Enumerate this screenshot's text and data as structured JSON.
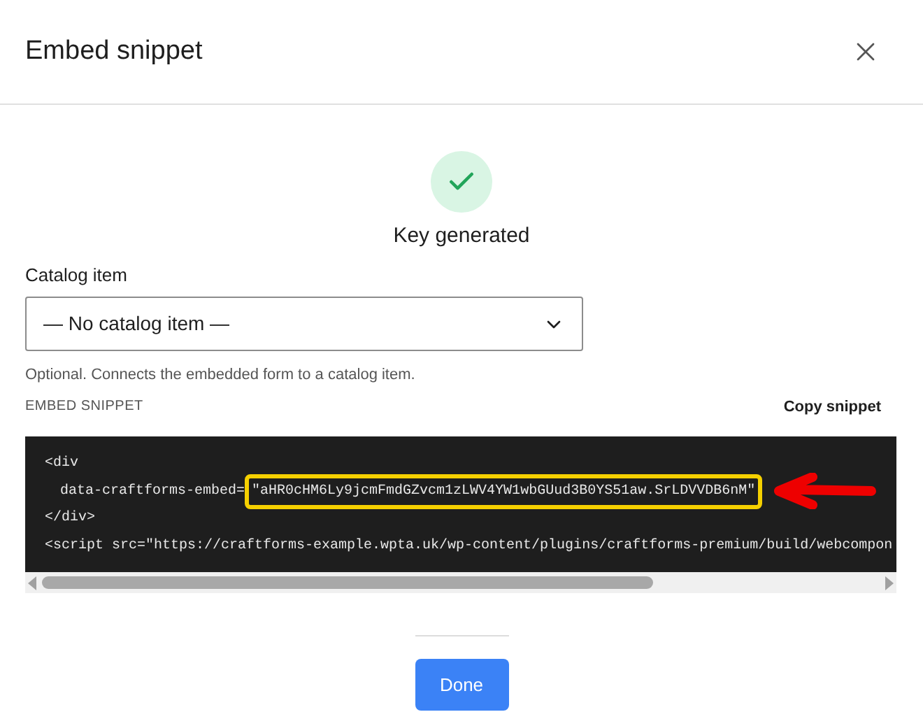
{
  "dialog": {
    "title": "Embed snippet"
  },
  "status": {
    "text": "Key generated"
  },
  "catalog_field": {
    "label": "Catalog item",
    "value": "— No catalog item —",
    "help": "Optional. Connects the embedded form to a catalog item."
  },
  "snippet": {
    "label": "EMBED SNIPPET",
    "copy_button": "Copy snippet",
    "lines": [
      {
        "indent": false,
        "text": "<div"
      },
      {
        "indent": true,
        "text": "data-craftforms-embed=",
        "highlight": "\"aHR0cHM6Ly9jcmFmdGZvcm1zLWV4YW1wbGUud3B0YS51aw.SrLDVVDB6nM\""
      },
      {
        "indent": false,
        "text": "</div>"
      },
      {
        "indent": false,
        "text": "<script src=\"https://craftforms-example.wpta.uk/wp-content/plugins/craftforms-premium/build/webcompon"
      }
    ]
  },
  "done_button": "Done"
}
